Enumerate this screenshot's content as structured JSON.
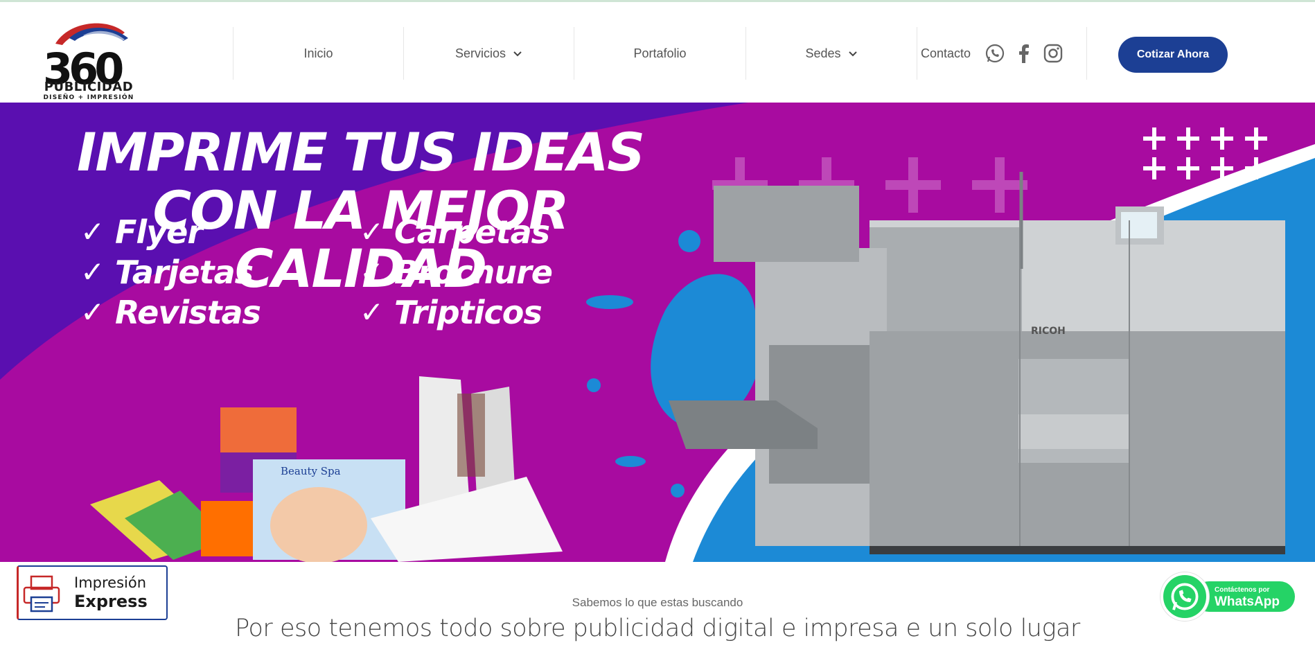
{
  "brand": {
    "logo_number": "360",
    "name": "PUBLICIDAD",
    "tagline": "DISEÑO + IMPRESIÓN"
  },
  "nav": {
    "items": [
      {
        "label": "Inicio",
        "has_dropdown": false
      },
      {
        "label": "Servicios",
        "has_dropdown": true
      },
      {
        "label": "Portafolio",
        "has_dropdown": false
      },
      {
        "label": "Sedes",
        "has_dropdown": true
      },
      {
        "label": "Contacto",
        "has_dropdown": false
      }
    ],
    "social_icons": [
      "whatsapp-icon",
      "facebook-icon",
      "instagram-icon"
    ],
    "cta_label": "Cotizar Ahora"
  },
  "banner": {
    "headline_line1": "IMPRIME TUS IDEAS",
    "headline_line2": "CON LA MEJOR CALIDAD",
    "left_list": [
      "Flyer",
      "Tarjetas",
      "Revistas"
    ],
    "right_list": [
      "Carpetas",
      "Brochure",
      "Tripticos"
    ],
    "check_symbol": "✓",
    "printer_brand": "RICOH",
    "sample_label": "Beauty Spa"
  },
  "express": {
    "line1": "Impresión",
    "line2": "Express"
  },
  "intro": {
    "small": "Sabemos lo que estas buscando",
    "big": "Por eso tenemos todo sobre publicidad digital e impresa e un solo lugar"
  },
  "whatsapp_badge": {
    "small": "Contáctenos por",
    "big": "WhatsApp"
  },
  "colors": {
    "brand_blue": "#1c3f94",
    "banner_purple": "#5a0fb0",
    "banner_magenta": "#a80ba0",
    "banner_blue": "#1c8ad6",
    "whatsapp_green": "#25d366"
  }
}
